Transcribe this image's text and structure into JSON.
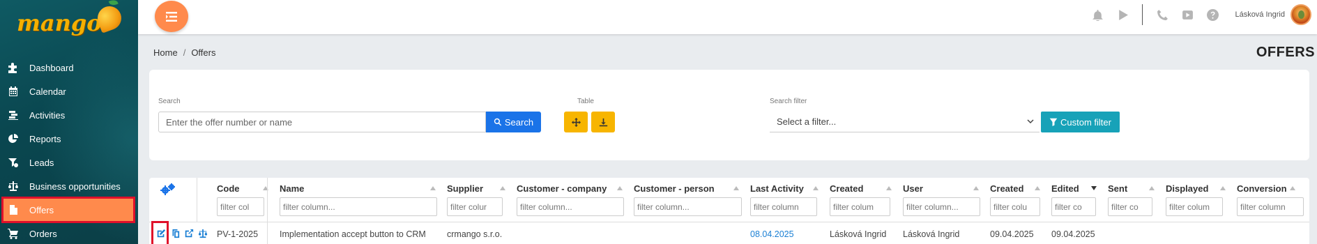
{
  "app": {
    "logo_text": "mango"
  },
  "sidebar": {
    "items": [
      {
        "label": "Dashboard",
        "icon": "puzzle-icon"
      },
      {
        "label": "Calendar",
        "icon": "calendar-icon"
      },
      {
        "label": "Activities",
        "icon": "activities-icon"
      },
      {
        "label": "Reports",
        "icon": "pie-chart-icon"
      },
      {
        "label": "Leads",
        "icon": "leads-icon"
      },
      {
        "label": "Business opportunities",
        "icon": "scales-icon"
      },
      {
        "label": "Offers",
        "icon": "file-icon",
        "active": true
      },
      {
        "label": "Orders",
        "icon": "cart-icon"
      }
    ]
  },
  "header": {
    "user_name": "Lásková Ingrid",
    "icons": [
      "bell-icon",
      "play-icon",
      "phone-icon",
      "youtube-icon",
      "help-icon"
    ]
  },
  "breadcrumb": {
    "home": "Home",
    "separator": "/",
    "current": "Offers"
  },
  "page_title": "OFFERS",
  "search": {
    "label": "Search",
    "placeholder": "Enter the offer number or name",
    "button_label": "Search",
    "table_label": "Table",
    "filter_label": "Search filter",
    "filter_value": "Select a filter...",
    "custom_filter_label": "Custom filter"
  },
  "table": {
    "columns": [
      {
        "title": "Code",
        "filter": "filter col"
      },
      {
        "title": "Name",
        "filter": "filter column..."
      },
      {
        "title": "Supplier",
        "filter": "filter colur"
      },
      {
        "title": "Customer - company",
        "filter": "filter column..."
      },
      {
        "title": "Customer - person",
        "filter": "filter column..."
      },
      {
        "title": "Last Activity",
        "filter": "filter column"
      },
      {
        "title": "Created",
        "filter": "filter colum"
      },
      {
        "title": "User",
        "filter": "filter column..."
      },
      {
        "title": "Created",
        "filter": "filter colu"
      },
      {
        "title": "Edited",
        "filter": "filter co"
      },
      {
        "title": "Sent",
        "filter": "filter co"
      },
      {
        "title": "Displayed",
        "filter": "filter colum"
      },
      {
        "title": "Conversion",
        "filter": "filter column"
      }
    ],
    "rows": [
      {
        "code": "PV-1-2025",
        "name": "Implementation accept button to CRM",
        "supplier": "crmango s.r.o.",
        "customer_company": "",
        "customer_person": "",
        "last_activity": "08.04.2025",
        "created_by": "Lásková Ingrid",
        "user": "Lásková Ingrid",
        "created": "09.04.2025",
        "edited": "09.04.2025",
        "sent": "",
        "displayed": "",
        "conversion": ""
      }
    ]
  },
  "colors": {
    "accent": "#ff8a4c",
    "primary": "#1a73e8",
    "warning": "#f7b500",
    "info": "#17a2b8",
    "sidebar": "#0a4750",
    "highlight": "#e0102a"
  }
}
